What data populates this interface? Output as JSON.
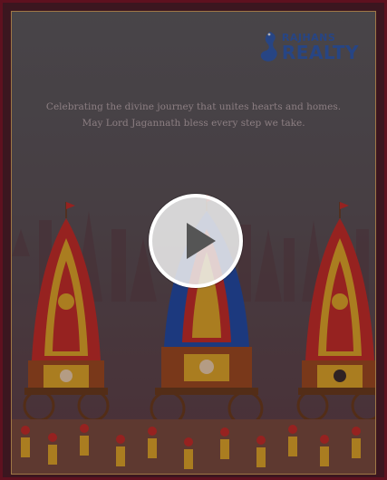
{
  "brand": {
    "name_top": "RAJHANS",
    "name_bottom": "REALTY",
    "color": "#2f5bb0"
  },
  "message": {
    "line1": "Celebrating the divine journey that unites hearts and homes.",
    "line2": "May Lord Jagannath bless every step we take."
  },
  "video": {
    "control": "play-icon"
  },
  "colors": {
    "frame": "#7a1224",
    "gold_border": "#d4a15a",
    "chariot_red": "#c82a26",
    "chariot_yellow": "#e3a826",
    "chariot_blue": "#1f4aa8",
    "wheel": "#6b3a1a"
  }
}
